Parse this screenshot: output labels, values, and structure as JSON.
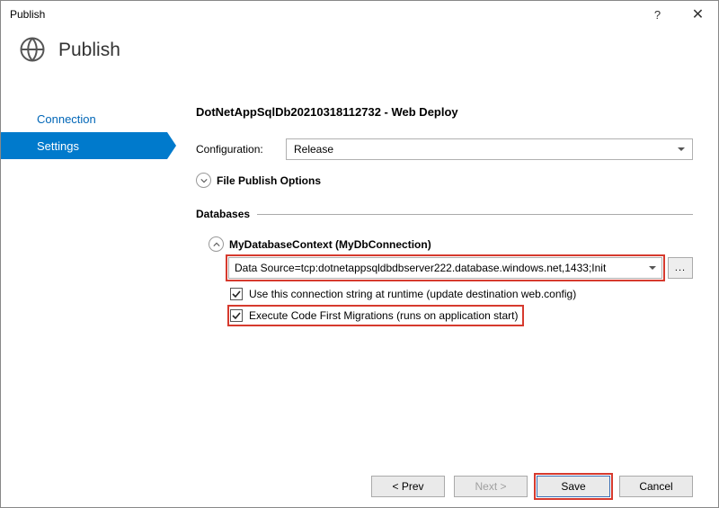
{
  "window": {
    "title": "Publish"
  },
  "header": {
    "title": "Publish"
  },
  "sidebar": {
    "items": [
      {
        "label": "Connection"
      },
      {
        "label": "Settings"
      }
    ]
  },
  "main": {
    "profileName": "DotNetAppSqlDb20210318112732 - Web Deploy",
    "configLabel": "Configuration:",
    "configValue": "Release",
    "filePublishLabel": "File Publish Options",
    "databasesLabel": "Databases",
    "dbContextLabel": "MyDatabaseContext (MyDbConnection)",
    "connString": "Data Source=tcp:dotnetappsqldbdbserver222.database.windows.net,1433;Init",
    "browseLabel": "...",
    "checkbox1": "Use this connection string at runtime (update destination web.config)",
    "checkbox2": "Execute Code First Migrations (runs on application start)"
  },
  "footer": {
    "prev": "< Prev",
    "next": "Next >",
    "save": "Save",
    "cancel": "Cancel"
  }
}
